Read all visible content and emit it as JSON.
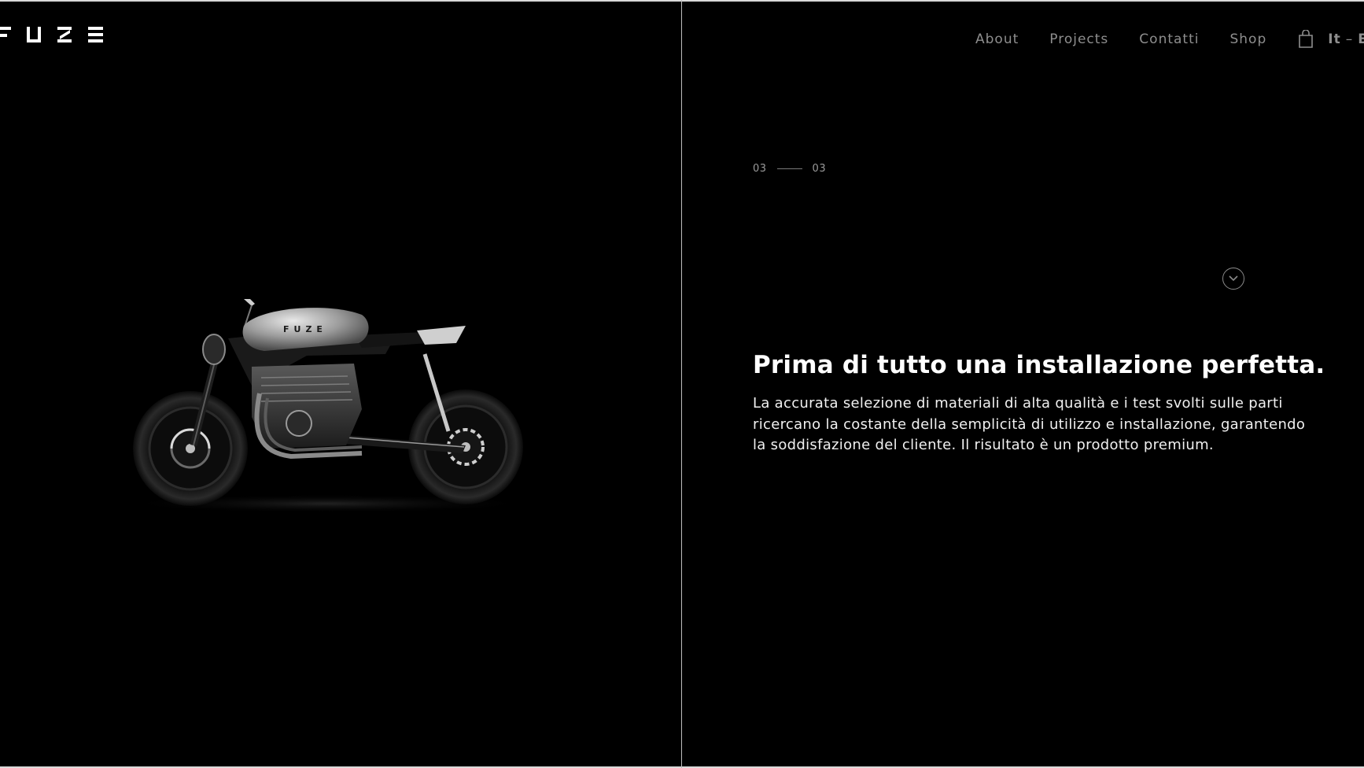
{
  "brand": {
    "logo_text": "FUZE",
    "logo_icon": "fuze-logo-icon"
  },
  "nav": {
    "items": [
      {
        "label": "About"
      },
      {
        "label": "Projects"
      },
      {
        "label": "Contatti"
      },
      {
        "label": "Shop"
      }
    ],
    "cart_icon": "shopping-bag-icon",
    "lang_it": "It",
    "lang_sep": "–",
    "lang_en": "En"
  },
  "hero": {
    "image": "motorcycle-image",
    "tank_logo_text": "FUZE"
  },
  "slider": {
    "current": "03",
    "total": "03"
  },
  "scroll": {
    "icon": "chevron-down-circle-icon"
  },
  "content": {
    "headline": "Prima di tutto una installazione perfetta.",
    "body_lines": [
      "La accurata selezione di materiali di alta qualità e i test svolti sulle parti",
      "ricercano la costante della semplicità di utilizzo e installazione, garantendo",
      "la soddisfazione del cliente. Il risultato è un prodotto premium."
    ]
  },
  "colors": {
    "background": "#000000",
    "nav_text": "#8e8e8e",
    "headline": "#ffffff",
    "divider": "#bdbdbd"
  }
}
